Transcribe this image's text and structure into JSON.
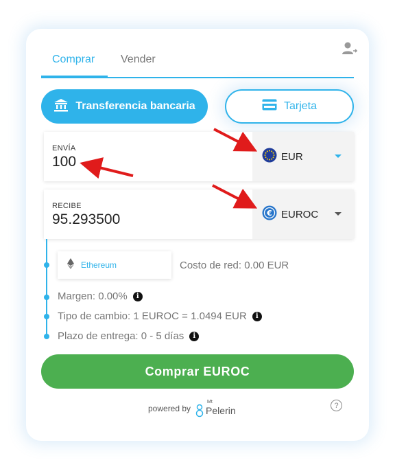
{
  "tabs": [
    {
      "label": "Comprar",
      "active": true
    },
    {
      "label": "Vender",
      "active": false
    }
  ],
  "payment_methods": {
    "bank_label": "Transferencia bancaria",
    "card_label": "Tarjeta"
  },
  "send": {
    "label": "ENVÍA",
    "value": "100",
    "currency": "EUR",
    "currency_icon": "eu-flag-icon"
  },
  "receive": {
    "label": "RECIBE",
    "value": "95.293500",
    "currency": "EUROC",
    "currency_icon": "euroc-coin-icon"
  },
  "network": {
    "name": "Ethereum",
    "cost": "Costo de red: 0.00 EUR"
  },
  "details": {
    "margin": "Margen: 0.00%",
    "exchange_rate": "Tipo de cambio: 1 EUROC = 1.0494 EUR",
    "delivery": "Plazo de entrega: 0 - 5 días"
  },
  "buy_button": "Comprar EUROC",
  "footer": {
    "powered_by": "powered by",
    "brand_prefix": "Mt",
    "brand_name": "Pelerin"
  },
  "colors": {
    "accent": "#2fb3ea",
    "buy": "#4caf50",
    "annotation_arrow": "#e01b1b"
  }
}
